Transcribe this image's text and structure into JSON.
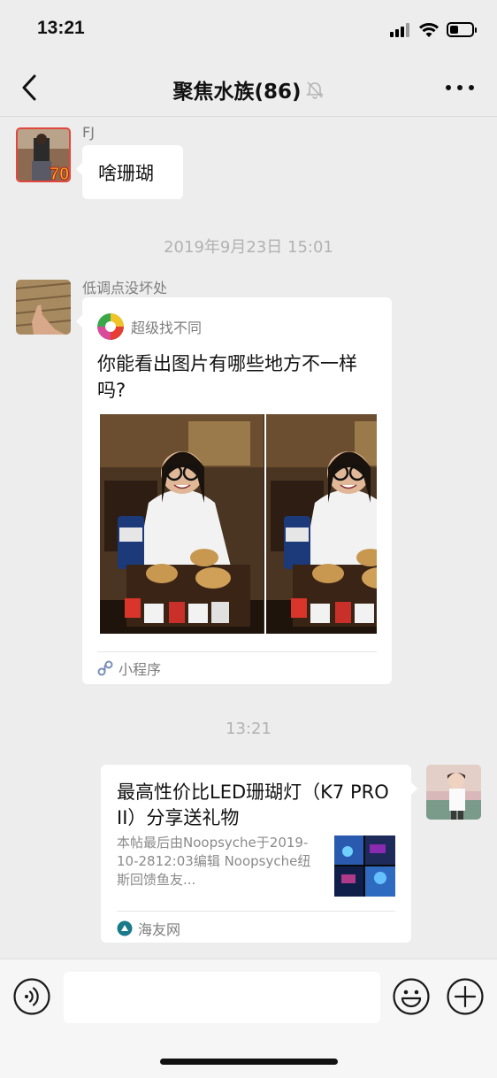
{
  "status_bar": {
    "time": "13:21"
  },
  "header": {
    "title": "聚焦水族(86)",
    "back_icon": "chevron-left-icon",
    "mute_icon": "bell-muted-icon",
    "more_icon": "more-dots-icon"
  },
  "messages": {
    "msg1": {
      "sender": "FJ",
      "avatar_badge": "70",
      "text": "啥珊瑚"
    },
    "timestamp1": "2019年9月23日 15:01",
    "msg2": {
      "sender": "低调点没坏处",
      "card": {
        "app_name": "超级找不同",
        "title": "你能看出图片有哪些地方不一样吗?",
        "footer": "小程序"
      }
    },
    "timestamp2": "13:21",
    "msg3": {
      "card": {
        "title": "最高性价比LED珊瑚灯（K7 PRO II）分享送礼物",
        "description": "本帖最后由Noopsyche于2019-10-2812:03编辑 Noopsyche纽斯回馈鱼友...",
        "source": "海友网"
      }
    }
  },
  "input_bar": {
    "placeholder": ""
  },
  "colors": {
    "background": "#ededed",
    "bubble": "#ffffff",
    "meta_text": "#b2b2b2"
  }
}
